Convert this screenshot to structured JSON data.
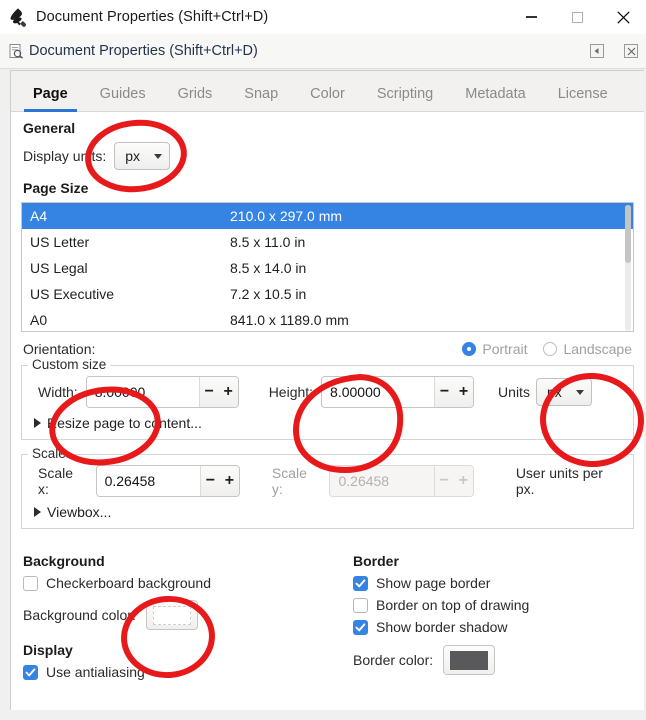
{
  "window": {
    "title": "Document Properties (Shift+Ctrl+D)",
    "app_icon": "inkscape-logo-icon",
    "controls": {
      "minimize": "minimize-icon",
      "maximize": "maximize-icon",
      "close": "close-icon"
    }
  },
  "dock": {
    "icon": "document-properties-icon",
    "title": "Document Properties (Shift+Ctrl+D)",
    "collapse_icon": "collapse-left-icon",
    "close_icon": "close-dock-icon"
  },
  "tabs": [
    {
      "label": "Page",
      "active": true
    },
    {
      "label": "Guides",
      "active": false
    },
    {
      "label": "Grids",
      "active": false
    },
    {
      "label": "Snap",
      "active": false
    },
    {
      "label": "Color",
      "active": false
    },
    {
      "label": "Scripting",
      "active": false
    },
    {
      "label": "Metadata",
      "active": false
    },
    {
      "label": "License",
      "active": false
    }
  ],
  "general": {
    "heading": "General",
    "display_units_label": "Display units:",
    "display_units_value": "px"
  },
  "page_size": {
    "heading": "Page Size",
    "rows": [
      {
        "name": "A4",
        "dims": "210.0 x 297.0 mm",
        "selected": true
      },
      {
        "name": "US Letter",
        "dims": "8.5 x 11.0 in",
        "selected": false
      },
      {
        "name": "US Legal",
        "dims": "8.5 x 14.0 in",
        "selected": false
      },
      {
        "name": "US Executive",
        "dims": "7.2 x 10.5 in",
        "selected": false
      },
      {
        "name": "A0",
        "dims": "841.0 x 1189.0 mm",
        "selected": false
      }
    ]
  },
  "orientation": {
    "label": "Orientation:",
    "portrait_label": "Portrait",
    "landscape_label": "Landscape",
    "selected": "Portrait"
  },
  "custom_size": {
    "legend": "Custom size",
    "width_label": "Width:",
    "width_value": "8.00000",
    "height_label": "Height:",
    "height_value": "8.00000",
    "units_label": "Units",
    "units_value": "px",
    "resize_expander": "Resize page to content..."
  },
  "scale": {
    "legend": "Scale",
    "scale_x_label": "Scale x:",
    "scale_x_value": "0.26458",
    "scale_y_label": "Scale y:",
    "scale_y_value": "0.26458",
    "units_note": "User units per px.",
    "viewbox_expander": "Viewbox..."
  },
  "background": {
    "heading": "Background",
    "checkerboard_label": "Checkerboard background",
    "checkerboard_checked": false,
    "color_label": "Background color:",
    "color_value": "#ffffff"
  },
  "display": {
    "heading": "Display",
    "antialiasing_label": "Use antialiasing",
    "antialiasing_checked": true
  },
  "border": {
    "heading": "Border",
    "show_page_border_label": "Show page border",
    "show_page_border_checked": true,
    "border_on_top_label": "Border on top of drawing",
    "border_on_top_checked": false,
    "show_border_shadow_label": "Show border shadow",
    "show_border_shadow_checked": true,
    "color_label": "Border color:",
    "color_value": "#59595b"
  },
  "annotations": {
    "color": "#e8191b",
    "marks": [
      "circle-display-units-dropdown",
      "circle-width-field",
      "circle-height-field",
      "circle-units-dropdown",
      "circle-background-color-swatch"
    ]
  },
  "colors": {
    "accent": "#3584e4",
    "tab_underline": "#2c75d6",
    "selection": "#3584e4",
    "annotation_red": "#e8191b"
  }
}
